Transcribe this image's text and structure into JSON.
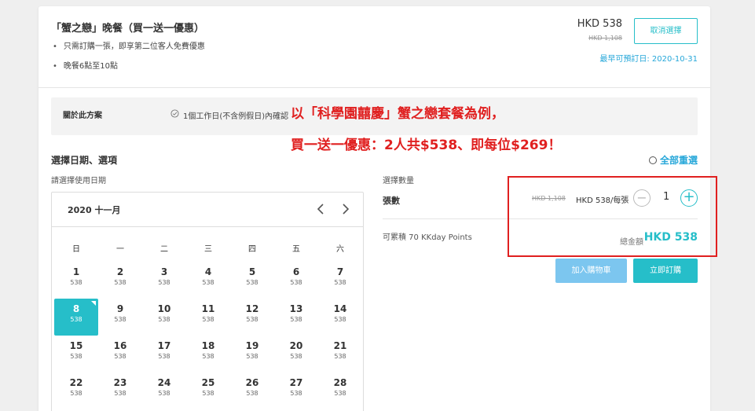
{
  "package": {
    "title": "「蟹之戀」晚餐（買一送一優惠）",
    "bullets": [
      "只需訂購一張，即享第二位客人免費優惠",
      "晚餐6點至10點"
    ],
    "price": "HKD 538",
    "original_price": "HKD 1,108",
    "cancel_label": "取消選擇",
    "earliest_date": "最早可預訂日: 2020-10-31"
  },
  "about": {
    "label": "關於此方案",
    "check_icon": "check-circle-icon",
    "confirm_text": "1個工作日(不含例假日)內確認"
  },
  "annotation": {
    "line1": "以「科學園囍慶」蟹之戀套餐為例，",
    "line2": "買一送一優惠：2人共$538、即每位$269！",
    "color": "#e02020"
  },
  "selection": {
    "title": "選擇日期、選項",
    "reset_label": "全部重選",
    "date_label": "請選擇使用日期"
  },
  "calendar": {
    "month": "2020 十一月",
    "prev_icon": "chevron-left-icon",
    "next_icon": "chevron-right-icon",
    "weekdays": [
      "日",
      "一",
      "二",
      "三",
      "四",
      "五",
      "六"
    ],
    "weeks": [
      [
        {
          "day": "1",
          "price": "538"
        },
        {
          "day": "2",
          "price": "538"
        },
        {
          "day": "3",
          "price": "538"
        },
        {
          "day": "4",
          "price": "538"
        },
        {
          "day": "5",
          "price": "538"
        },
        {
          "day": "6",
          "price": "538"
        },
        {
          "day": "7",
          "price": "538"
        }
      ],
      [
        {
          "day": "8",
          "price": "538",
          "selected": true
        },
        {
          "day": "9",
          "price": "538"
        },
        {
          "day": "10",
          "price": "538"
        },
        {
          "day": "11",
          "price": "538"
        },
        {
          "day": "12",
          "price": "538"
        },
        {
          "day": "13",
          "price": "538"
        },
        {
          "day": "14",
          "price": "538"
        }
      ],
      [
        {
          "day": "15",
          "price": "538"
        },
        {
          "day": "16",
          "price": "538"
        },
        {
          "day": "17",
          "price": "538"
        },
        {
          "day": "18",
          "price": "538"
        },
        {
          "day": "19",
          "price": "538"
        },
        {
          "day": "20",
          "price": "538"
        },
        {
          "day": "21",
          "price": "538"
        }
      ],
      [
        {
          "day": "22",
          "price": "538"
        },
        {
          "day": "23",
          "price": "538"
        },
        {
          "day": "24",
          "price": "538"
        },
        {
          "day": "25",
          "price": "538"
        },
        {
          "day": "26",
          "price": "538"
        },
        {
          "day": "27",
          "price": "538"
        },
        {
          "day": "28",
          "price": "538"
        }
      ]
    ]
  },
  "quantity": {
    "label": "選擇數量",
    "unit_label": "張數",
    "unit_original": "HKD 1,108",
    "unit_price": "HKD 538/每張",
    "minus": "−",
    "value": "1",
    "plus": "+",
    "points": "可累積 70 KKday Points",
    "total_label": "總金額",
    "total_value": "HKD 538"
  },
  "actions": {
    "cart_label": "加入購物車",
    "order_label": "立即訂購"
  },
  "colors": {
    "accent": "#26bec9",
    "link": "#26a7d9",
    "cart": "#7cc6ef"
  }
}
